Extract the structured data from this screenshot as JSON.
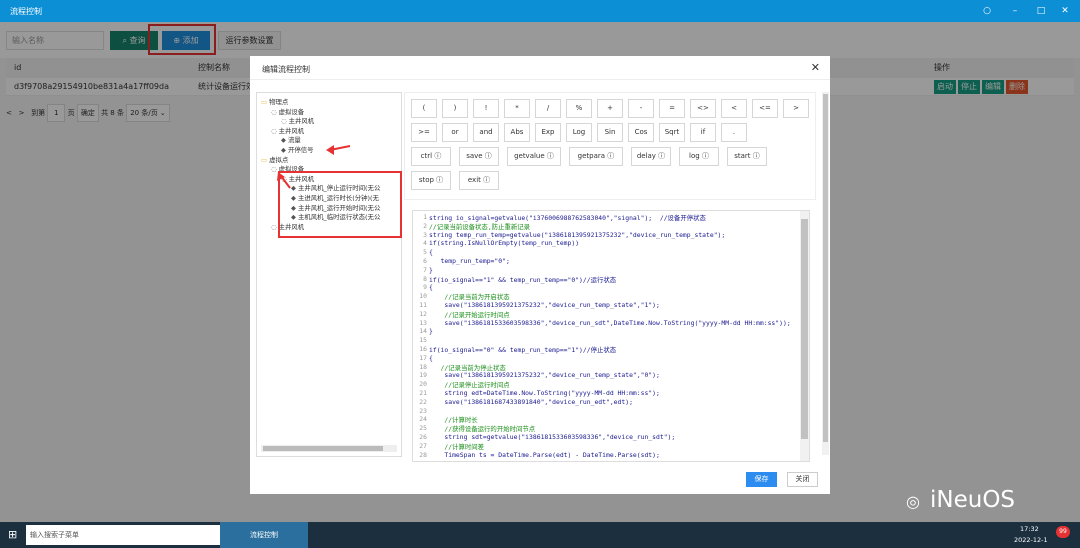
{
  "window": {
    "title": "流程控制",
    "controls": [
      "○",
      "–",
      "□",
      "✕"
    ]
  },
  "toolbar": {
    "search_placeholder": "输入名称",
    "query_label": "查询",
    "add_label": "添加",
    "run_params_label": "运行参数设置"
  },
  "table": {
    "headers": [
      "id",
      "控制名称",
      "操作"
    ],
    "rows": [
      {
        "id": "d3f9708a29154910be831a4a17ff09da",
        "name": "统计设备运行效",
        "actions": [
          {
            "label": "启动",
            "color": "#16a085"
          },
          {
            "label": "停止",
            "color": "#16a085"
          },
          {
            "label": "编辑",
            "color": "#16a085"
          },
          {
            "label": "删除",
            "color": "#e4572e"
          }
        ]
      }
    ],
    "pager": {
      "prev": "<",
      "next": ">",
      "goto": "到第",
      "page": "1",
      "page_unit": "页",
      "confirm": "确定",
      "total": "共 8 条",
      "per_page": "20 条/页"
    }
  },
  "modal": {
    "title": "编辑流程控制",
    "tree": [
      {
        "label": "物理点",
        "level": 0,
        "icon": "folder-icon"
      },
      {
        "label": "虚拟设备",
        "level": 1,
        "icon": "device-icon"
      },
      {
        "label": "主井风机",
        "level": 2,
        "icon": "device-icon"
      },
      {
        "label": "主井风机",
        "level": 1,
        "icon": "device-icon"
      },
      {
        "label": "流量",
        "level": 2,
        "icon": "tag-icon"
      },
      {
        "label": "开停信号",
        "level": 2,
        "icon": "tag-icon"
      },
      {
        "label": "虚拟点",
        "level": 0,
        "icon": "folder-icon"
      },
      {
        "label": "虚拟设备",
        "level": 1,
        "icon": "device-icon"
      },
      {
        "label": "主井风机",
        "level": 2,
        "icon": "device-icon"
      },
      {
        "label": "主井风机_停止运行时间(无公",
        "level": 3,
        "icon": "tag-icon"
      },
      {
        "label": "主进风机_运行时长(分钟)(无",
        "level": 3,
        "icon": "tag-icon"
      },
      {
        "label": "主井风机_运行开始时间(无公",
        "level": 3,
        "icon": "tag-icon"
      },
      {
        "label": "主机风机_临时运行状态(无公",
        "level": 3,
        "icon": "tag-icon"
      },
      {
        "label": "主井风机",
        "level": 1,
        "icon": "device-icon"
      }
    ],
    "keys": [
      [
        "(",
        ")",
        "!",
        "*",
        "/",
        "%",
        "+",
        "-",
        "=",
        "<>",
        "<",
        "<=",
        ">"
      ],
      [
        ">=",
        "or",
        "and",
        "Abs",
        "Exp",
        "Log",
        "Sin",
        "Cos",
        "Sqrt",
        "if",
        "."
      ],
      [
        "ctrl",
        "save",
        "getvalue",
        "getpara",
        "delay",
        "log",
        "start"
      ],
      [
        "stop",
        "exit"
      ]
    ],
    "code": [
      {
        "n": "1",
        "t": "string io_signal=getvalue(\"i376006988762583040\",\"signal\");  //设备开停状态"
      },
      {
        "n": "2",
        "t": "//记录当前设备状态,防止重新记录"
      },
      {
        "n": "3",
        "t": "string temp_run_temp=getvalue(\"i386181395921375232\",\"device_run_temp_state\");"
      },
      {
        "n": "4",
        "t": "if(string.IsNullOrEmpty(temp_run_temp))"
      },
      {
        "n": "5",
        "t": "{"
      },
      {
        "n": "6",
        "t": "   temp_run_temp=\"0\";"
      },
      {
        "n": "7",
        "t": "}"
      },
      {
        "n": "8",
        "t": "if(io_signal==\"1\" && temp_run_temp==\"0\")//运行状态"
      },
      {
        "n": "9",
        "t": "{"
      },
      {
        "n": "10",
        "t": "    //记录当前为开启状态"
      },
      {
        "n": "11",
        "t": "    save(\"i386181395921375232\",\"device_run_temp_state\",\"1\");"
      },
      {
        "n": "12",
        "t": "    //记录开始运行时间点"
      },
      {
        "n": "13",
        "t": "    save(\"i386181533603598336\",\"device_run_sdt\",DateTime.Now.ToString(\"yyyy-MM-dd HH:mm:ss\"));"
      },
      {
        "n": "14",
        "t": "}"
      },
      {
        "n": "15",
        "t": ""
      },
      {
        "n": "16",
        "t": "if(io_signal==\"0\" && temp_run_temp==\"1\")//停止状态"
      },
      {
        "n": "17",
        "t": "{"
      },
      {
        "n": "18",
        "t": "   //记录当前为停止状态"
      },
      {
        "n": "19",
        "t": "    save(\"i386181395921375232\",\"device_run_temp_state\",\"0\");"
      },
      {
        "n": "20",
        "t": "    //记录停止运行时间点"
      },
      {
        "n": "21",
        "t": "    string edt=DateTime.Now.ToString(\"yyyy-MM-dd HH:mm:ss\");"
      },
      {
        "n": "22",
        "t": "    save(\"i386181687433891840\",\"device_run_edt\",edt);"
      },
      {
        "n": "23",
        "t": ""
      },
      {
        "n": "24",
        "t": "    //计算时长"
      },
      {
        "n": "25",
        "t": "    //获得设备运行的开始时间节点"
      },
      {
        "n": "26",
        "t": "    string sdt=getvalue(\"i386181533603598336\",\"device_run_sdt\");"
      },
      {
        "n": "27",
        "t": "    //计算时间差"
      },
      {
        "n": "28",
        "t": "    TimeSpan ts = DateTime.Parse(edt) - DateTime.Parse(sdt);"
      }
    ],
    "save_label": "保存",
    "close_label": "关闭"
  },
  "taskbar": {
    "search_placeholder": "输入搜索子菜单",
    "app_label": "流程控制",
    "time": "17:32",
    "date": "2022-12-1"
  },
  "watermark": "iNeuOS",
  "colors": {
    "titlebar": "#0d8fd6",
    "highlight": "#e63232"
  }
}
